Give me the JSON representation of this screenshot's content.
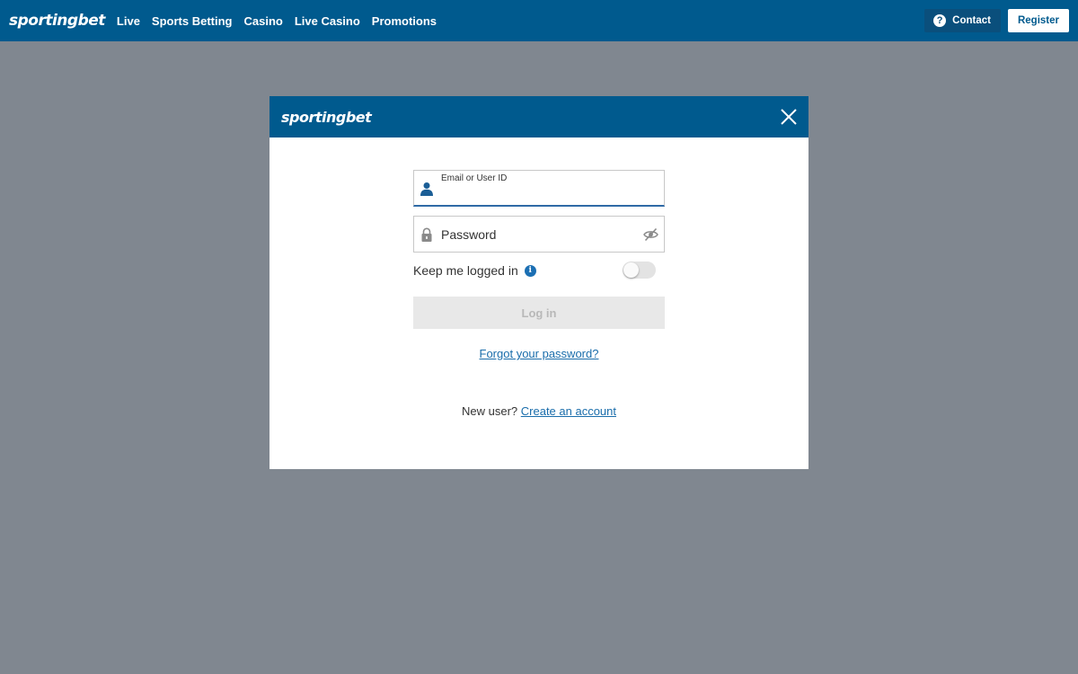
{
  "brand": {
    "logo_text": "sportingbet",
    "primary_color": "#005a8e",
    "overlay_color": "#808790"
  },
  "nav": {
    "items": [
      {
        "label": "Live"
      },
      {
        "label": "Sports Betting"
      },
      {
        "label": "Casino"
      },
      {
        "label": "Live Casino"
      },
      {
        "label": "Promotions"
      }
    ],
    "contact_label": "Contact",
    "register_label": "Register"
  },
  "login_modal": {
    "logo_text": "sportingbet",
    "email": {
      "label": "Email or User ID",
      "value": "",
      "icon": "user-icon"
    },
    "password": {
      "placeholder": "Password",
      "value": "",
      "icon": "lock-icon",
      "toggle_icon": "eye-hidden-icon"
    },
    "keep_logged_in": {
      "label": "Keep me logged in",
      "checked": false
    },
    "login_label": "Log in",
    "forgot_label": "Forgot your password?",
    "new_user_text": "New user?",
    "create_account_label": "Create an account"
  }
}
